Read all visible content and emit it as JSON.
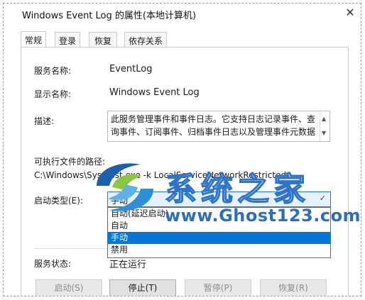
{
  "window": {
    "title": "Windows Event Log 的属性(本地计算机)"
  },
  "tabs": [
    {
      "label": "常规",
      "active": true
    },
    {
      "label": "登录",
      "active": false
    },
    {
      "label": "恢复",
      "active": false
    },
    {
      "label": "依存关系",
      "active": false
    }
  ],
  "general": {
    "service_name_label": "服务名称:",
    "service_name_value": "EventLog",
    "display_name_label": "显示名称:",
    "display_name_value": "Windows Event Log",
    "description_label": "描述:",
    "description_text": "此服务管理事件和事件日志。它支持日志记录事件、查询事件、订阅事件、归档事件日志以及管理事件元数据",
    "path_label": "可执行文件的路径:",
    "path_value": "C:\\Windows\\Sys                 host.exe -k LocalServiceNetworkRestricted",
    "startup_type_label": "启动类型(E):",
    "startup_type_value": "手动",
    "startup_options": [
      {
        "label": "自动(延迟启动)"
      },
      {
        "label": "自动"
      },
      {
        "label": "手动",
        "selected": true
      },
      {
        "label": "禁用"
      }
    ],
    "service_status_label": "服务状态:",
    "service_status_value": "正在运行"
  },
  "buttons": {
    "start": "启动(S)",
    "stop": "停止(T)",
    "pause": "暂停(P)",
    "resume": "恢复(R)"
  },
  "watermark": {
    "title": "系统之家",
    "url": "www.Ghost123.com"
  },
  "colors": {
    "selection": "#0078d7",
    "combo_focus": "#e5f1fb",
    "watermark_blue": "#2b6fc0"
  }
}
